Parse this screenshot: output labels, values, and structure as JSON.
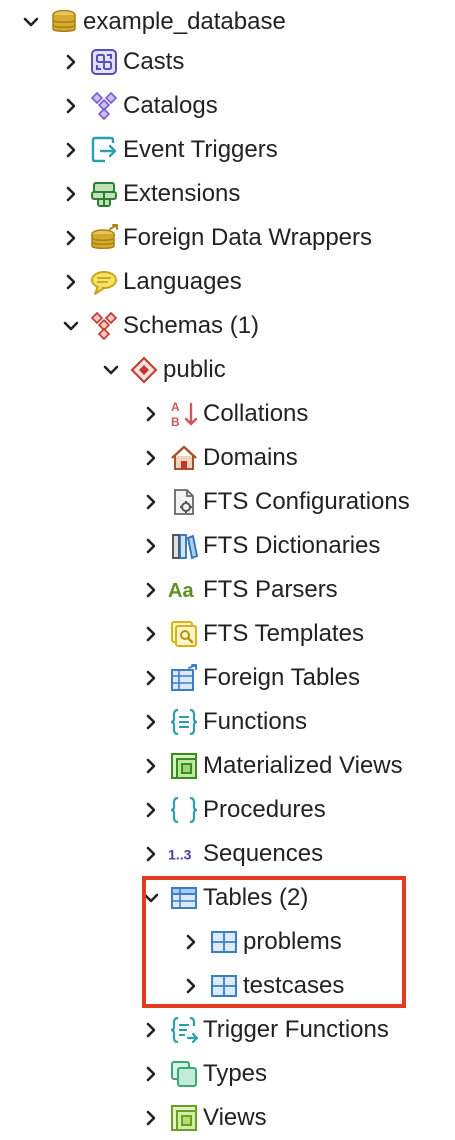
{
  "tree": {
    "root": {
      "label": "example_database",
      "icon": "database-icon",
      "expanded": true
    },
    "db_children": [
      {
        "label": "Casts",
        "icon": "casts-icon",
        "expanded": false
      },
      {
        "label": "Catalogs",
        "icon": "catalogs-icon",
        "expanded": false
      },
      {
        "label": "Event Triggers",
        "icon": "event-triggers-icon",
        "expanded": false
      },
      {
        "label": "Extensions",
        "icon": "extensions-icon",
        "expanded": false
      },
      {
        "label": "Foreign Data Wrappers",
        "icon": "foreign-data-wrappers-icon",
        "expanded": false
      },
      {
        "label": "Languages",
        "icon": "languages-icon",
        "expanded": false
      },
      {
        "label": "Schemas (1)",
        "icon": "schemas-icon",
        "expanded": true
      }
    ],
    "schema": {
      "label": "public",
      "icon": "schema-icon",
      "expanded": true
    },
    "schema_children": [
      {
        "label": "Collations",
        "icon": "collations-icon",
        "expanded": false
      },
      {
        "label": "Domains",
        "icon": "domains-icon",
        "expanded": false
      },
      {
        "label": "FTS Configurations",
        "icon": "fts-configurations-icon",
        "expanded": false
      },
      {
        "label": "FTS Dictionaries",
        "icon": "fts-dictionaries-icon",
        "expanded": false
      },
      {
        "label": "FTS Parsers",
        "icon": "fts-parsers-icon",
        "expanded": false
      },
      {
        "label": "FTS Templates",
        "icon": "fts-templates-icon",
        "expanded": false
      },
      {
        "label": "Foreign Tables",
        "icon": "foreign-tables-icon",
        "expanded": false
      },
      {
        "label": "Functions",
        "icon": "functions-icon",
        "expanded": false
      },
      {
        "label": "Materialized Views",
        "icon": "materialized-views-icon",
        "expanded": false
      },
      {
        "label": "Procedures",
        "icon": "procedures-icon",
        "expanded": false
      },
      {
        "label": "Sequences",
        "icon": "sequences-icon",
        "expanded": false
      },
      {
        "label": "Tables (2)",
        "icon": "tables-icon",
        "expanded": true
      }
    ],
    "tables": [
      {
        "label": "problems",
        "icon": "table-icon",
        "expanded": false
      },
      {
        "label": "testcases",
        "icon": "table-icon",
        "expanded": false
      }
    ],
    "schema_children_after": [
      {
        "label": "Trigger Functions",
        "icon": "trigger-functions-icon",
        "expanded": false
      },
      {
        "label": "Types",
        "icon": "types-icon",
        "expanded": false
      },
      {
        "label": "Views",
        "icon": "views-icon",
        "expanded": false
      }
    ],
    "icon_text": {
      "collations_top": "A",
      "collations_bottom": "B",
      "fts_parsers": "Aa",
      "sequences": "1..3"
    }
  },
  "colors": {
    "highlight": "#e63a1e",
    "chevron": "#222222",
    "label": "#222222"
  }
}
